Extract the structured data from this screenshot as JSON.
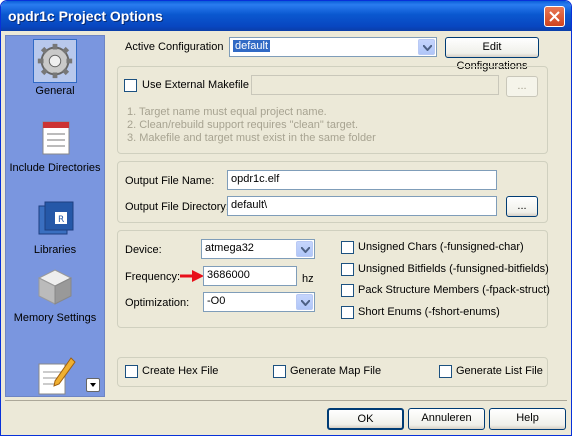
{
  "window": {
    "title": "opdr1c Project Options"
  },
  "sidebar": {
    "items": [
      {
        "label": "General",
        "icon": "gear-icon",
        "selected": true
      },
      {
        "label": "Include Directories",
        "icon": "include-directories-icon"
      },
      {
        "label": "Libraries",
        "icon": "libraries-icon"
      },
      {
        "label": "Memory Settings",
        "icon": "memory-settings-icon"
      },
      {
        "label": "",
        "icon": "custom-options-icon"
      }
    ]
  },
  "config": {
    "label": "Active Configuration",
    "value": "default",
    "edit_button": "Edit Configurations"
  },
  "makefile": {
    "checkbox_label": "Use External Makefile",
    "path_value": "",
    "browse_label": "...",
    "notes": [
      "1. Target name must equal project name.",
      "2. Clean/rebuild support requires \"clean\" target.",
      "3. Makefile and target must exist in the same folder"
    ]
  },
  "output": {
    "file_name_label": "Output File Name:",
    "file_name_value": "opdr1c.elf",
    "dir_label": "Output File Directory:",
    "dir_value": "default\\",
    "browse_label": "..."
  },
  "device": {
    "device_label": "Device:",
    "device_value": "atmega32",
    "frequency_label": "Frequency:",
    "frequency_value": "3686000",
    "frequency_unit": "hz",
    "optimization_label": "Optimization:",
    "optimization_value": "-O0",
    "options": [
      "Unsigned Chars (-funsigned-char)",
      "Unsigned Bitfields (-funsigned-bitfields)",
      "Pack Structure Members (-fpack-struct)",
      "Short Enums (-fshort-enums)"
    ]
  },
  "generate": [
    "Create Hex File",
    "Generate Map File",
    "Generate List File"
  ],
  "buttons": {
    "ok": "OK",
    "cancel": "Annuleren",
    "help": "Help"
  },
  "colors": {
    "title_bar": "#0a58d0",
    "selection": "#316ac5",
    "arrow": "#e8101a"
  }
}
